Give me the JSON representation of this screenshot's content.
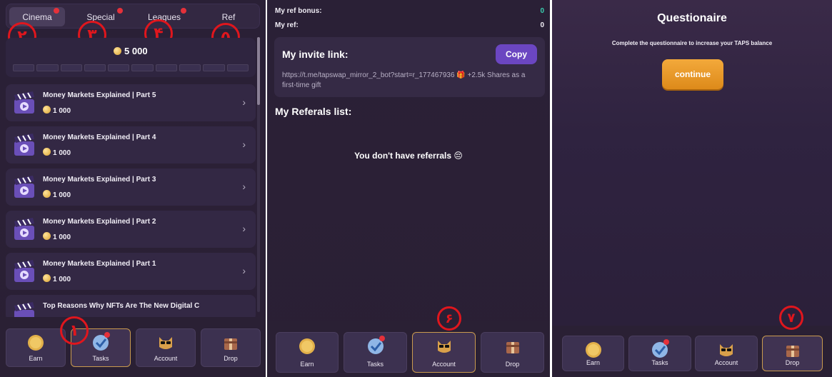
{
  "panel1": {
    "tabs": [
      {
        "label": "Cinema",
        "active": true
      },
      {
        "label": "Special",
        "active": false
      },
      {
        "label": "Leagues",
        "active": false
      },
      {
        "label": "Ref",
        "active": false
      }
    ],
    "annotations": [
      "٢",
      "٣",
      "۴",
      "۵",
      "١"
    ],
    "balance": "5 000",
    "progress_segments": 10,
    "tasks": [
      {
        "title": "Money Markets Explained | Part 5",
        "reward": "1 000"
      },
      {
        "title": "Money Markets Explained | Part 4",
        "reward": "1 000"
      },
      {
        "title": "Money Markets Explained | Part 3",
        "reward": "1 000"
      },
      {
        "title": "Money Markets Explained | Part 2",
        "reward": "1 000"
      },
      {
        "title": "Money Markets Explained | Part 1",
        "reward": "1 000"
      },
      {
        "title": "Top Reasons Why NFTs Are The New Digital C",
        "reward": ""
      }
    ]
  },
  "nav": {
    "earn": "Earn",
    "tasks": "Tasks",
    "account": "Account",
    "drop": "Drop"
  },
  "panel2": {
    "ref_bonus_label": "My ref bonus:",
    "ref_bonus_value": "0",
    "ref_label": "My ref:",
    "ref_value": "0",
    "invite_heading": "My invite link:",
    "copy_label": "Copy",
    "invite_link": "https://t.me/tapswap_mirror_2_bot?start=r_177467936 🎁 +2.5k Shares as a first-time gift",
    "referals_heading": "My Referals list:",
    "no_referrals": "You don't have referrals 😔",
    "annotation": "۶"
  },
  "panel3": {
    "title": "Questionaire",
    "subtitle": "Complete the questionnaire to increase your TAPS balance",
    "continue_label": "continue",
    "annotation": "٧"
  },
  "colors": {
    "accent_purple": "#6b46c1",
    "button_orange": "#e8961f",
    "badge_red": "#e5313a",
    "annotation_red": "#e0161d",
    "bonus_green": "#3ad0b0"
  },
  "icons": {
    "coin": "coin-icon",
    "video": "clapperboard-video-icon",
    "chevron": "chevron-right-icon",
    "tasks": "checkmark-tasks-icon",
    "account": "cat-sunglasses-avatar-icon",
    "drop": "gift-box-icon"
  }
}
